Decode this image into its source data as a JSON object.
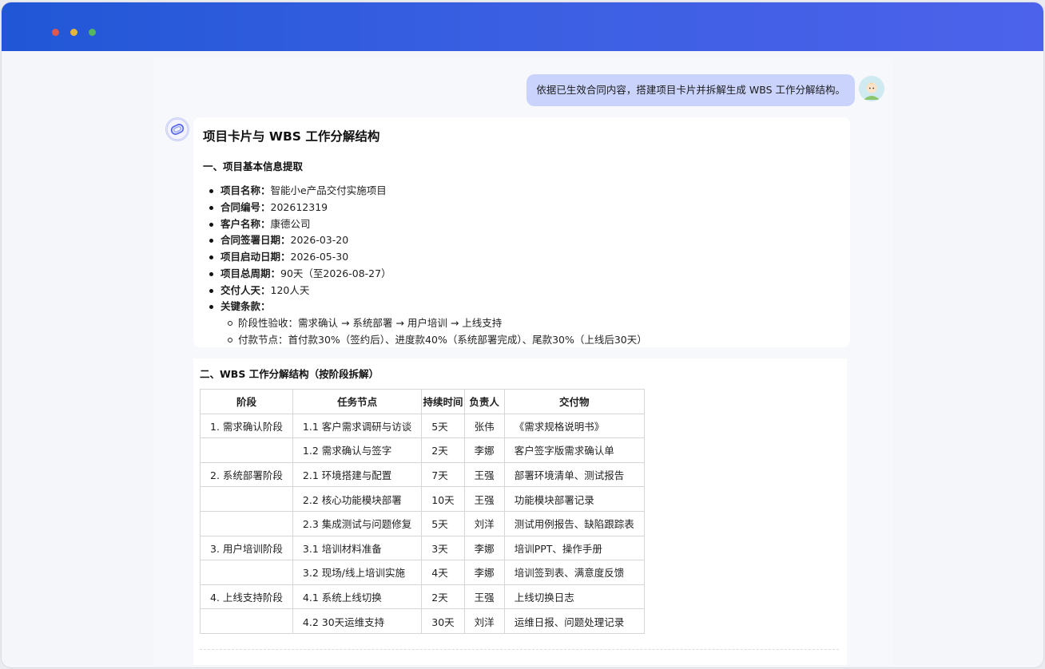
{
  "colors": {
    "accent": "#3b5fe2",
    "user_bubble": "#c9d3fb"
  },
  "chat": {
    "user_message": "依据已生效合同内容，搭建项目卡片并拆解生成 WBS 工作分解结构。"
  },
  "card": {
    "title": "项目卡片与 WBS 工作分解结构",
    "section1_title": "一、项目基本信息提取",
    "info": [
      {
        "key": "项目名称",
        "sep": "：",
        "value": "智能小e产品交付实施项目"
      },
      {
        "key": "合同编号",
        "sep": "：",
        "value": "202612319"
      },
      {
        "key": "客户名称",
        "sep": "：",
        "value": "康德公司"
      },
      {
        "key": "合同签署日期",
        "sep": "：",
        "value": "2026-03-20"
      },
      {
        "key": "项目启动日期",
        "sep": "：",
        "value": "2026-05-30"
      },
      {
        "key": "项目总周期",
        "sep": "：",
        "value": "90天（至2026-08-27）"
      },
      {
        "key": "交付人天",
        "sep": "：",
        "value": "120人天"
      },
      {
        "key": "关键条款",
        "sep": "：",
        "value": ""
      }
    ],
    "key_terms": [
      "阶段性验收：需求确认 → 系统部署 → 用户培训 → 上线支持",
      "付款节点：首付款30%（签约后）、进度款40%（系统部署完成）、尾款30%（上线后30天）"
    ],
    "section2_title": "二、WBS 工作分解结构（按阶段拆解）",
    "table": {
      "headers": [
        "阶段",
        "任务节点",
        "持续时间",
        "负责人",
        "交付物"
      ],
      "rows": [
        [
          "1. 需求确认阶段",
          "1.1 客户需求调研与访谈",
          "5天",
          "张伟",
          "《需求规格说明书》"
        ],
        [
          "",
          "1.2 需求确认与签字",
          "2天",
          "李娜",
          "客户签字版需求确认单"
        ],
        [
          "2. 系统部署阶段",
          "2.1 环境搭建与配置",
          "7天",
          "王强",
          "部署环境清单、测试报告"
        ],
        [
          "",
          "2.2 核心功能模块部署",
          "10天",
          "王强",
          "功能模块部署记录"
        ],
        [
          "",
          "2.3 集成测试与问题修复",
          "5天",
          "刘洋",
          "测试用例报告、缺陷跟踪表"
        ],
        [
          "3. 用户培训阶段",
          "3.1 培训材料准备",
          "3天",
          "李娜",
          "培训PPT、操作手册"
        ],
        [
          "",
          "3.2 现场/线上培训实施",
          "4天",
          "李娜",
          "培训签到表、满意度反馈"
        ],
        [
          "4. 上线支持阶段",
          "4.1 系统上线切换",
          "2天",
          "王强",
          "上线切换日志"
        ],
        [
          "",
          "4.2 30天运维支持",
          "30天",
          "刘洋",
          "运维日报、问题处理记录"
        ]
      ]
    }
  }
}
